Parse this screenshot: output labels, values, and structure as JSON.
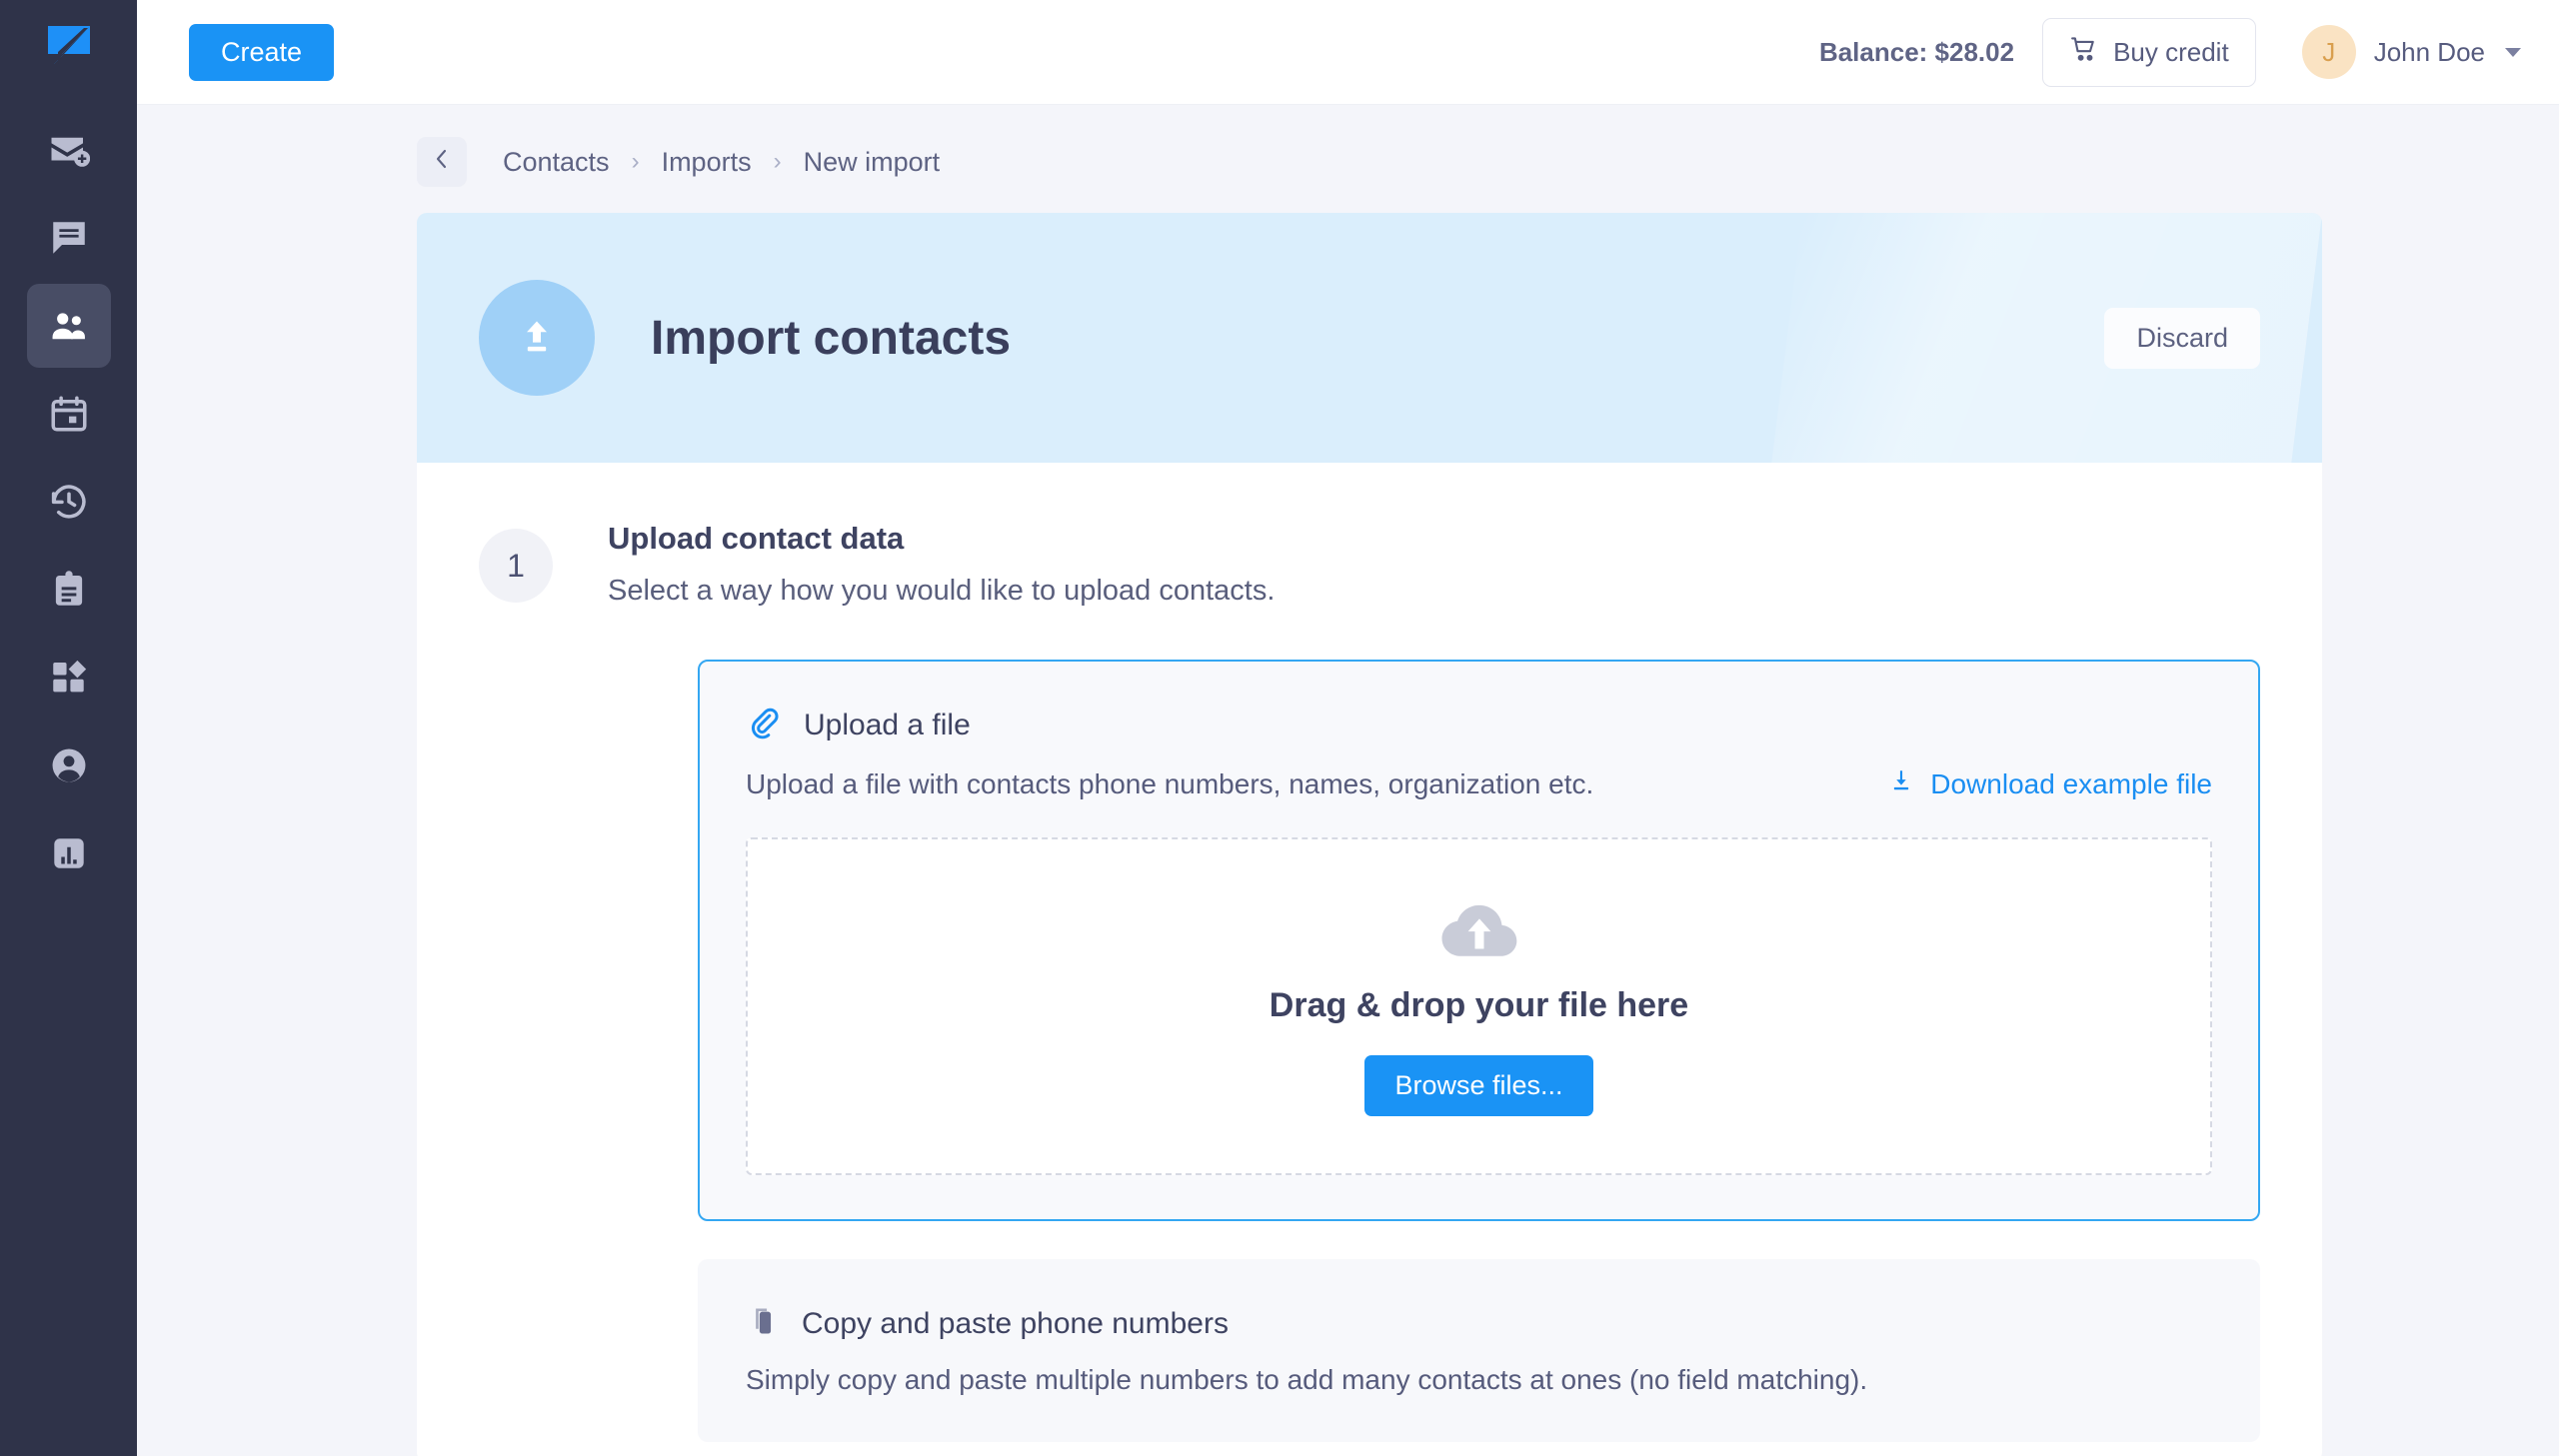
{
  "colors": {
    "accent_blue": "#1a93f5",
    "sidebar_bg": "#2f3349",
    "sidebar_active": "#484d65",
    "banner_bg": "#daeefc",
    "page_bg": "#f4f5fa",
    "text_dark": "#3e4361",
    "text_muted": "#565b7c",
    "avatar_bg": "#fae3c3"
  },
  "sidebar": {
    "logo_name": "speech-bubble-logo",
    "items": [
      {
        "icon": "mail-add-icon",
        "label": "Send message",
        "active": false
      },
      {
        "icon": "chat-icon",
        "label": "Conversations",
        "active": false
      },
      {
        "icon": "contacts-icon",
        "label": "Contacts",
        "active": true
      },
      {
        "icon": "calendar-icon",
        "label": "Campaigns",
        "active": false
      },
      {
        "icon": "history-icon",
        "label": "History",
        "active": false
      },
      {
        "icon": "clipboard-icon",
        "label": "Reports",
        "active": false
      },
      {
        "icon": "apps-icon",
        "label": "Apps",
        "active": false
      },
      {
        "icon": "account-circle-icon",
        "label": "Account",
        "active": false
      },
      {
        "icon": "analytics-icon",
        "label": "Analytics",
        "active": false
      }
    ]
  },
  "topbar": {
    "create_label": "Create",
    "balance_label": "Balance: $28.02",
    "buy_credit_label": "Buy credit",
    "buy_credit_icon": "shopping-cart-icon",
    "user_initial": "J",
    "user_name": "John Doe",
    "caret_icon": "chevron-down-icon"
  },
  "breadcrumb": {
    "back_icon": "chevron-left-icon",
    "items": [
      "Contacts",
      "Imports",
      "New import"
    ],
    "separator": "›"
  },
  "banner": {
    "icon": "upload-icon",
    "title": "Import contacts",
    "discard_label": "Discard"
  },
  "step": {
    "number": "1",
    "title": "Upload contact data",
    "subtitle": "Select a way how you would like to upload contacts."
  },
  "options": [
    {
      "id": "upload-a-file",
      "selected": true,
      "icon": "paperclip-icon",
      "title": "Upload a file",
      "description": "Upload a file with contacts phone numbers, names, organization etc.",
      "download_link": {
        "icon": "download-icon",
        "label": "Download example file"
      },
      "dropzone": {
        "icon": "cloud-upload-icon",
        "title": "Drag & drop your file here",
        "button_label": "Browse files..."
      }
    },
    {
      "id": "copy-and-paste",
      "selected": false,
      "icon": "copy-icon",
      "title": "Copy and paste phone numbers",
      "description": "Simply copy and paste multiple numbers to add many contacts at ones (no field matching)."
    }
  ]
}
